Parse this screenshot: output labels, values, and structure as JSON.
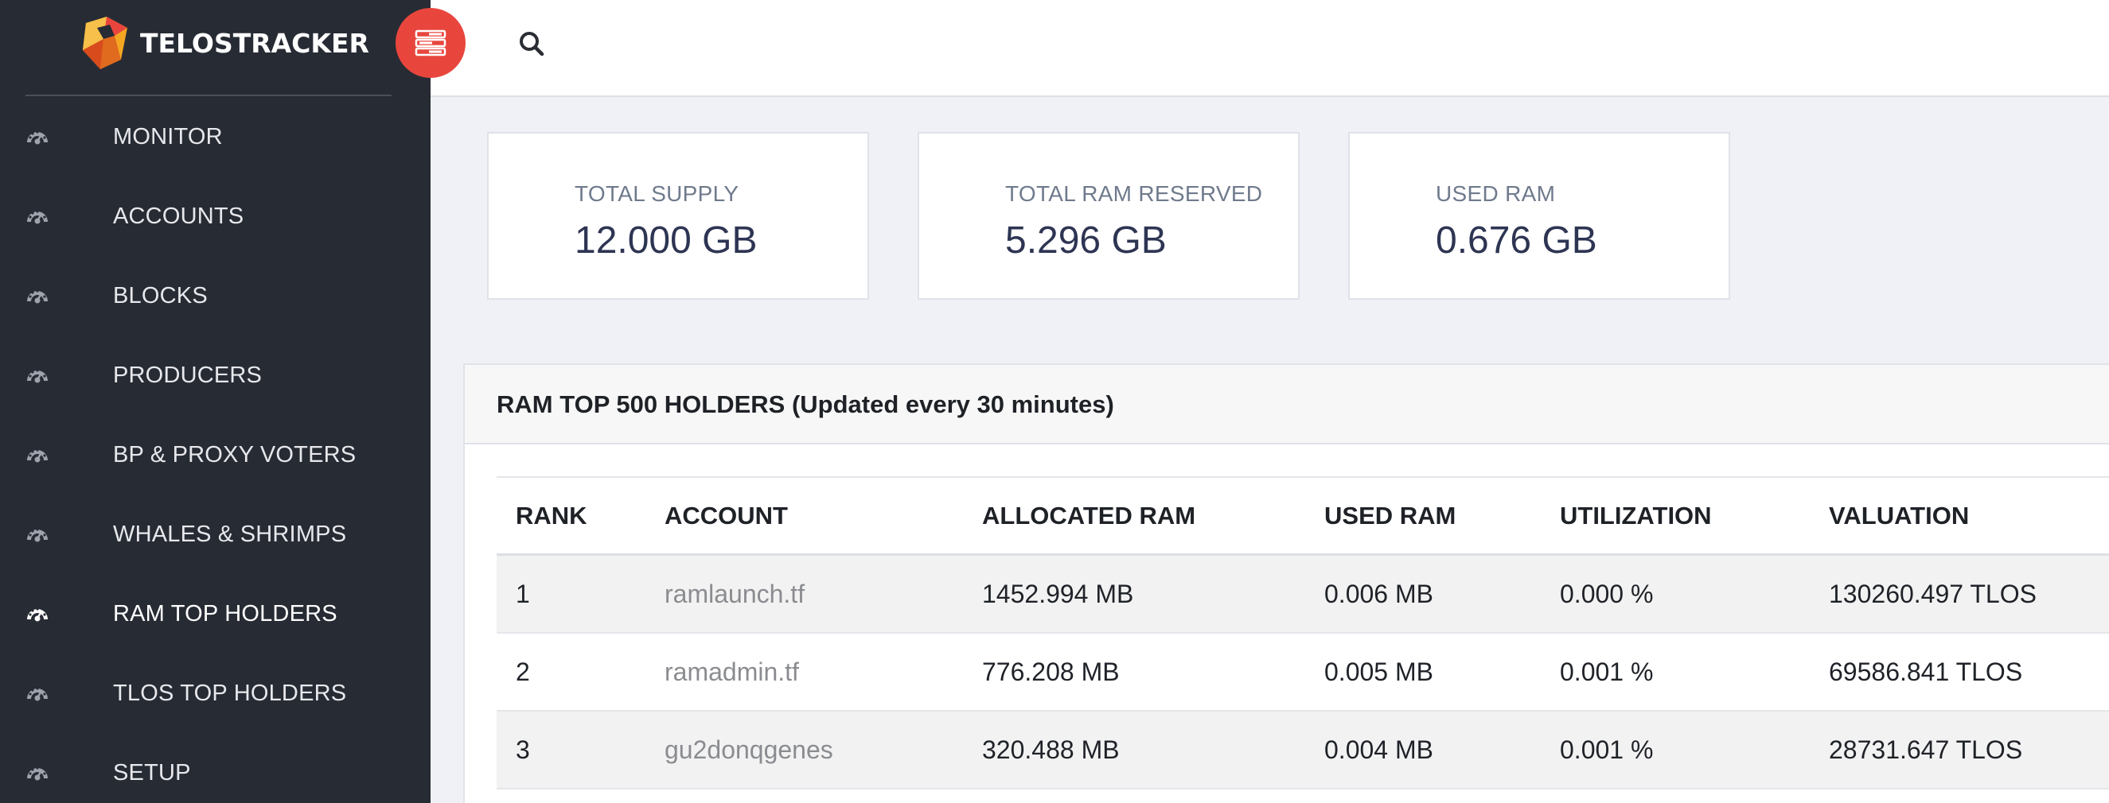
{
  "brand": {
    "name": "TELOSTRACKER"
  },
  "sidebar": {
    "items": [
      {
        "label": "MONITOR",
        "icon": "dashboard-icon"
      },
      {
        "label": "ACCOUNTS",
        "icon": "dashboard-icon"
      },
      {
        "label": "BLOCKS",
        "icon": "dashboard-icon"
      },
      {
        "label": "PRODUCERS",
        "icon": "dashboard-icon"
      },
      {
        "label": "BP & PROXY VOTERS",
        "icon": "dashboard-icon"
      },
      {
        "label": "WHALES & SHRIMPS",
        "icon": "dashboard-icon"
      },
      {
        "label": "RAM TOP HOLDERS",
        "icon": "dashboard-icon",
        "active": true
      },
      {
        "label": "TLOS TOP HOLDERS",
        "icon": "dashboard-icon"
      },
      {
        "label": "SETUP",
        "icon": "dashboard-icon"
      }
    ]
  },
  "topbar": {
    "toggle_icon": "menu-toggle-icon",
    "search_icon": "search-icon"
  },
  "stats": [
    {
      "label": "TOTAL SUPPLY",
      "value": "12.000 GB"
    },
    {
      "label": "TOTAL RAM RESERVED",
      "value": "5.296 GB"
    },
    {
      "label": "USED RAM",
      "value": "0.676 GB"
    }
  ],
  "table": {
    "title": "RAM TOP 500 HOLDERS (Updated every 30 minutes)",
    "columns": [
      "RANK",
      "ACCOUNT",
      "ALLOCATED RAM",
      "USED RAM",
      "UTILIZATION",
      "VALUATION"
    ],
    "rows": [
      {
        "rank": "1",
        "account": "ramlaunch.tf",
        "allocated": "1452.994 MB",
        "used": "0.006 MB",
        "utilization": "0.000 %",
        "valuation": "130260.497 TLOS"
      },
      {
        "rank": "2",
        "account": "ramadmin.tf",
        "allocated": "776.208 MB",
        "used": "0.005 MB",
        "utilization": "0.001 %",
        "valuation": "69586.841 TLOS"
      },
      {
        "rank": "3",
        "account": "gu2donqgenes",
        "allocated": "320.488 MB",
        "used": "0.004 MB",
        "utilization": "0.001 %",
        "valuation": "28731.647 TLOS"
      }
    ]
  },
  "colors": {
    "sidebar_bg": "#272b34",
    "accent_red": "#e8463d",
    "page_bg": "#f0f1f6",
    "stat_value": "#2e3553"
  }
}
